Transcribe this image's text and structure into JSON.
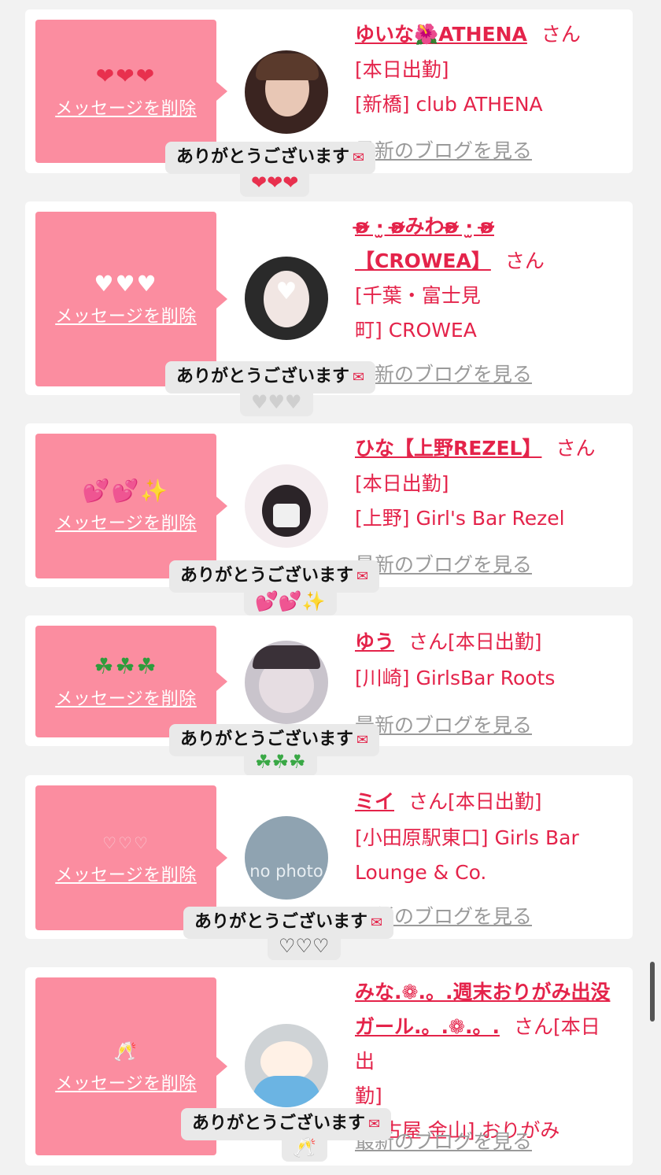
{
  "cards": [
    {
      "msg_emoji": "❤❤❤",
      "delete_label": "メッセージを削除",
      "name": "ゆいな🌺ATHENA",
      "san": "さん",
      "line1": "[本日出勤]",
      "line2": "[新橋] club ATHENA",
      "blog": "最新のブログを見る",
      "bubble": "ありがとうございます",
      "bubble_emoji": "❤❤❤"
    },
    {
      "msg_emoji": "♥♥♥",
      "delete_label": "メッセージを削除",
      "name_line1": "ʚ̴̶̷̷ ·̫ ʚ̴̶̷̷みわʚ̴̶̷̷ ·̫ ʚ̴̶̷̷",
      "name_line2": "【CROWEA】",
      "san": "さん",
      "line1": "[千葉・富士見",
      "line2": "町] CROWEA",
      "blog": "最新のブログを見る",
      "bubble": "ありがとうございます",
      "bubble_emoji": "♥♥♥"
    },
    {
      "msg_emoji": "💕💕✨",
      "delete_label": "メッセージを削除",
      "name": "ひな【上野REZEL】",
      "san": "さん",
      "line1": "[本日出勤]",
      "line2": "[上野] Girl's Bar Rezel",
      "blog": "最新のブログを見る",
      "bubble": "ありがとうございます",
      "bubble_emoji": "💕💕✨"
    },
    {
      "msg_emoji": "☘☘☘",
      "delete_label": "メッセージを削除",
      "name": "ゆう",
      "san": "さん[本日出勤]",
      "line2": "[川崎] GirlsBar Roots",
      "blog": "最新のブログを見る",
      "bubble": "ありがとうございます",
      "bubble_emoji": "☘☘☘"
    },
    {
      "msg_emoji": "♡♡♡",
      "delete_label": "メッセージを削除",
      "name": "ミイ",
      "san": "さん[本日出勤]",
      "line2": "[小田原駅東口] Girls Bar",
      "line3": "Lounge & Co.",
      "avatar_text": "no photo",
      "blog": "最新のブログを見る",
      "bubble": "ありがとうございます",
      "bubble_emoji": "♡♡♡"
    },
    {
      "msg_emoji": "🥂",
      "delete_label": "メッセージを削除",
      "name_line1": "みな.❁.。.週末おりがみ出没",
      "name_line2": "ガール.。.❁.。.",
      "san": "さん[本日出",
      "line1": "勤]",
      "line2": "[名古屋 金山] おりがみ",
      "blog": "最新のブログを見る",
      "bubble": "ありがとうございます",
      "bubble_emoji": "🥂"
    }
  ],
  "colors": {
    "accent": "#e4234a",
    "pink_box": "#fb8da0",
    "background": "#f2f2f2"
  },
  "icons": {
    "envelope": "love-letter-icon"
  }
}
